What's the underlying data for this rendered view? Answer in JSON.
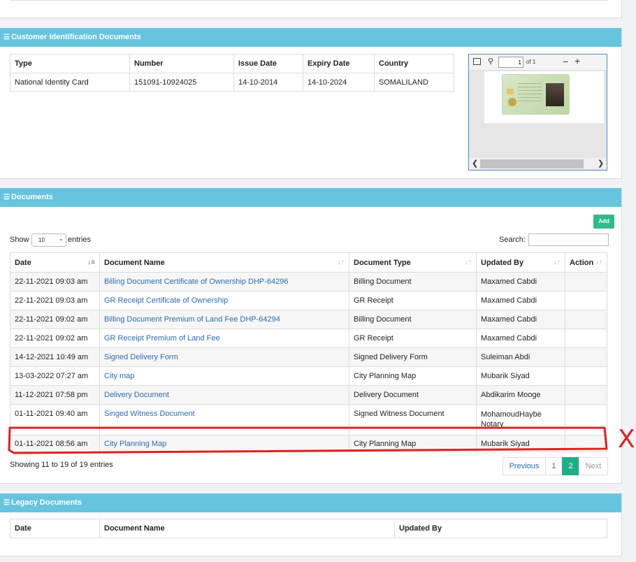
{
  "identification": {
    "title": "Customer Identification Documents",
    "headers": [
      "Type",
      "Number",
      "Issue Date",
      "Expiry Date",
      "Country"
    ],
    "row": {
      "type": "National Identity Card",
      "number": "151091-10924025",
      "issue": "14-10-2014",
      "expiry": "14-10-2024",
      "country": "SOMALILAND"
    },
    "viewer": {
      "page": "1",
      "of": "of 1"
    }
  },
  "documents": {
    "title": "Documents",
    "add_label": "Add",
    "show_label": "Show",
    "entries_value": "10",
    "entries_label": "entries",
    "search_label": "Search:",
    "headers": {
      "date": "Date",
      "name": "Document Name",
      "type": "Document Type",
      "updated": "Updated By",
      "action": "Action"
    },
    "rows": [
      {
        "date": "22-11-2021 09:03 am",
        "name": "Billing Document Certificate of Ownership DHP-64296",
        "type": "Billing Document",
        "updated": "Maxamed Cabdi"
      },
      {
        "date": "22-11-2021 09:03 am",
        "name": "GR Receipt Certificate of Ownership",
        "type": "GR Receipt",
        "updated": "Maxamed Cabdi"
      },
      {
        "date": "22-11-2021 09:02 am",
        "name": "Billing Document Premium of Land Fee DHP-64294",
        "type": "Billing Document",
        "updated": "Maxamed Cabdi"
      },
      {
        "date": "22-11-2021 09:02 am",
        "name": "GR Receipt Premium of Land Fee",
        "type": "GR Receipt",
        "updated": "Maxamed Cabdi"
      },
      {
        "date": "14-12-2021 10:49 am",
        "name": "Signed Delivery Form",
        "type": "Signed Delivery Form",
        "updated": "Suleiman Abdi"
      },
      {
        "date": "13-03-2022 07:27 am",
        "name": "City map",
        "type": "City Planning Map",
        "updated": "Mubarik Siyad"
      },
      {
        "date": "11-12-2021 07:58 pm",
        "name": "Delivery Document",
        "type": "Delivery Document",
        "updated": "Abdikarim Mooge"
      },
      {
        "date": "01-11-2021 09:40 am",
        "name": "Singed Witness Document",
        "type": "Signed Witness Document",
        "updated": "MohamoudHaybe Notary"
      },
      {
        "date": "01-11-2021 08:56 am",
        "name": "City Planning Map",
        "type": "City Planning Map",
        "updated": "Mubarik Siyad"
      }
    ],
    "info": "Showing 11 to 19 of 19 entries",
    "pagination": {
      "prev": "Previous",
      "p1": "1",
      "p2": "2",
      "next": "Next"
    },
    "annotation_mark": "X"
  },
  "legacy": {
    "title": "Legacy Documents",
    "headers": {
      "date": "Date",
      "name": "Document Name",
      "updated": "Updated By"
    }
  }
}
